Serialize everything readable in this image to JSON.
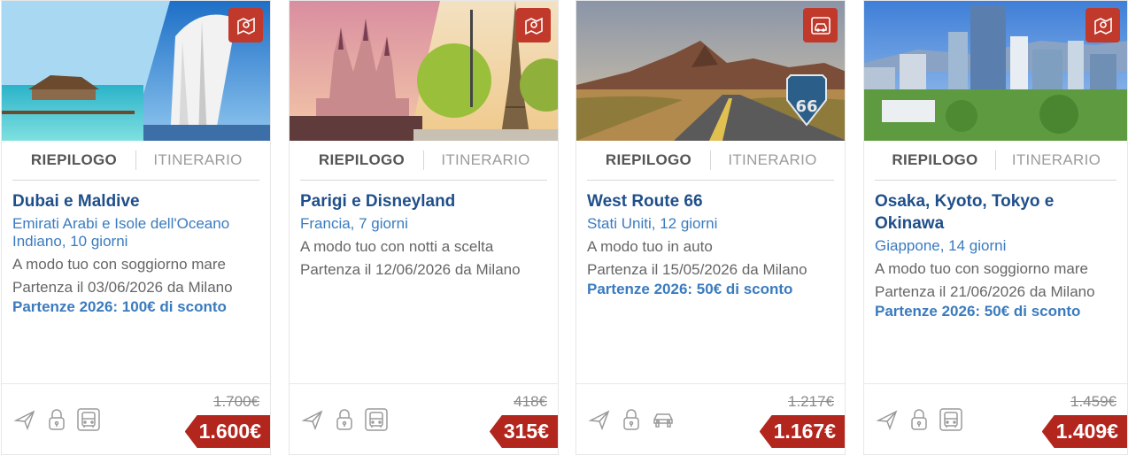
{
  "tabs": {
    "summary": "RIEPILOGO",
    "itinerary": "ITINERARIO"
  },
  "colors": {
    "title": "#1f4f8a",
    "subtitle": "#3a7bbf",
    "badge": "#c0392b",
    "price_tag": "#b3261e",
    "icon_gray": "#9a9a9a"
  },
  "cards": [
    {
      "badge_icon": "map-location-icon",
      "title": "Dubai e Maldive",
      "subtitle": "Emirati Arabi e Isole dell'Oceano Indiano, 10 giorni",
      "description": "A modo tuo con soggiorno mare",
      "departure": "Partenza il 03/06/2026 da Milano",
      "promo": "Partenze 2026: 100€ di sconto",
      "old_price": "1.700€",
      "price": "1.600€",
      "features": [
        "plane-icon",
        "lock-icon",
        "bus-icon"
      ]
    },
    {
      "badge_icon": "map-location-icon",
      "title": "Parigi e Disneyland",
      "subtitle": "Francia, 7 giorni",
      "description": "A modo tuo con notti a scelta",
      "departure": "Partenza il 12/06/2026 da Milano",
      "promo": "",
      "old_price": "418€",
      "price": "315€",
      "features": [
        "plane-icon",
        "lock-icon",
        "bus-icon"
      ]
    },
    {
      "badge_icon": "car-route-icon",
      "title": "West Route 66",
      "subtitle": "Stati Uniti, 12 giorni",
      "description": "A modo tuo in auto",
      "departure": "Partenza il 15/05/2026 da Milano",
      "promo": "Partenze 2026: 50€ di sconto",
      "old_price": "1.217€",
      "price": "1.167€",
      "features": [
        "plane-icon",
        "lock-icon",
        "car-icon"
      ]
    },
    {
      "badge_icon": "map-location-icon",
      "title": "Osaka, Kyoto, Tokyo e Okinawa",
      "subtitle": "Giappone, 14 giorni",
      "description": "A modo tuo con soggiorno mare",
      "departure": "Partenza il 21/06/2026 da Milano",
      "promo": "Partenze 2026: 50€ di sconto",
      "old_price": "1.459€",
      "price": "1.409€",
      "features": [
        "plane-icon",
        "lock-icon",
        "bus-icon"
      ]
    }
  ]
}
